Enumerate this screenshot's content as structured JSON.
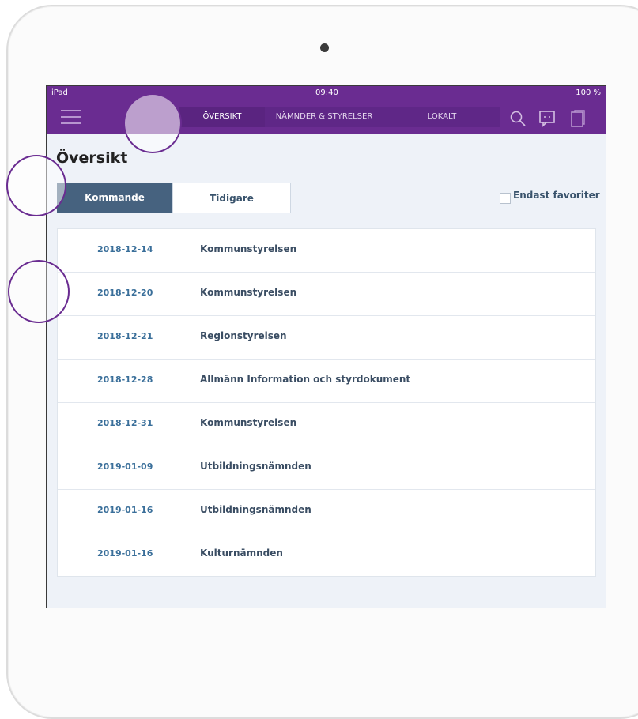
{
  "status": {
    "device": "iPad",
    "time": "09:40",
    "battery": "100 %"
  },
  "nav": {
    "tabs": [
      {
        "label": "ÖVERSIKT"
      },
      {
        "label": "NÄMNDER & STYRELSER"
      },
      {
        "label": "LOKALT"
      }
    ],
    "icons": [
      "search-icon",
      "chat-icon",
      "document-icon"
    ]
  },
  "page": {
    "title": "Översikt"
  },
  "segments": {
    "active": "Kommande",
    "inactive": "Tidigare"
  },
  "favorites": {
    "label": "Endast favoriter"
  },
  "meetings": [
    {
      "date": "2018-12-14",
      "title": "Kommunstyrelsen"
    },
    {
      "date": "2018-12-20",
      "title": "Kommunstyrelsen"
    },
    {
      "date": "2018-12-21",
      "title": "Regionstyrelsen"
    },
    {
      "date": "2018-12-28",
      "title": "Allmänn Information och styrdokument"
    },
    {
      "date": "2018-12-31",
      "title": "Kommunstyrelsen"
    },
    {
      "date": "2019-01-09",
      "title": "Utbildningsnämnden"
    },
    {
      "date": "2019-01-16",
      "title": "Utbildningsnämnden"
    },
    {
      "date": "2019-01-16",
      "title": "Kulturnämnden"
    }
  ],
  "colors": {
    "nav_purple": "#6a2c91",
    "segment_active": "#46627f",
    "date_blue": "#3a6f9a"
  }
}
